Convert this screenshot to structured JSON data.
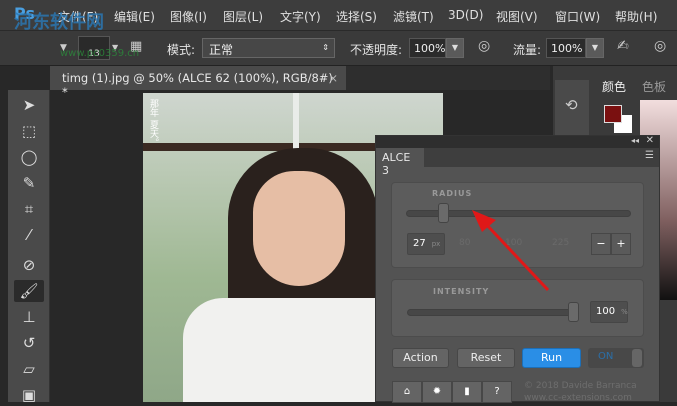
{
  "menubar": {
    "logo": "Ps",
    "items": [
      "文件(F)",
      "编辑(E)",
      "图像(I)",
      "图层(L)",
      "文字(Y)",
      "选择(S)",
      "滤镜(T)",
      "3D(D)",
      "视图(V)",
      "窗口(W)",
      "帮助(H)"
    ]
  },
  "options": {
    "brush_size": "13",
    "mode_label": "模式:",
    "mode_value": "正常",
    "opacity_label": "不透明度:",
    "opacity_value": "100%",
    "flow_label": "流量:",
    "flow_value": "100%"
  },
  "document_tab": {
    "title": "timg (1).jpg @ 50% (ALCE 62 (100%), RGB/8#) *",
    "close": "×"
  },
  "right_panel": {
    "tabs": [
      "颜色",
      "色板"
    ],
    "foreground_color": "#7a1010",
    "background_color": "#ffffff"
  },
  "alce": {
    "title": "ALCE 3",
    "radius": {
      "label": "RADIUS",
      "value": "27",
      "unit": "px",
      "presets": [
        "80",
        "100",
        "225"
      ],
      "minus": "−",
      "plus": "+",
      "slider_fraction": 0.15
    },
    "intensity": {
      "label": "INTENSITY",
      "value": "100",
      "unit": "%",
      "slider_fraction": 1.0
    },
    "buttons": {
      "action": "Action",
      "reset": "Reset",
      "run": "Run",
      "toggle": "ON"
    },
    "copyright": "© 2018 Davide Barranca",
    "website": "www.cc-extensions.com"
  },
  "photo_text": "那年 夏天。",
  "watermark": {
    "name": "河东软件网",
    "url": "www.pc0359.cn"
  }
}
